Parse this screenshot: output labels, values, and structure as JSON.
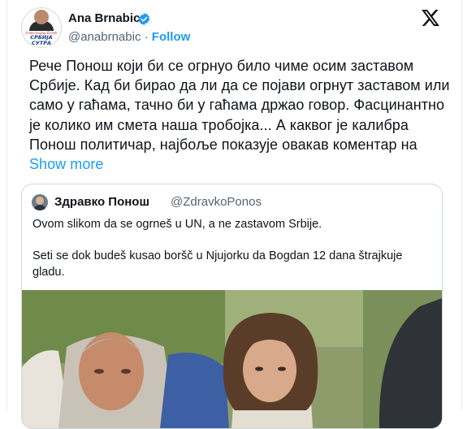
{
  "tweet": {
    "author": {
      "name": "Ana Brnabic",
      "handle": "@anabrnabic",
      "separator": "·",
      "follow_label": "Follow",
      "avatar_small_text": "Александар Вучић",
      "avatar_logo_line1": "СРБИЈА",
      "avatar_logo_line2": "СУТРА",
      "verified_icon": "verified-badge-icon"
    },
    "brand_icon": "x-logo-icon",
    "text": "Рече Понош који би се огрнуо било чиме осим заставом Србије. Кад би бирао да ли да се појави огрнут заставом или само у гаћама, тачно би у гаћама држао говор. Фасцинантно је колико им смета наша тробојка... А каквог је калибра Понош политичар, најбоље показује овакав коментар на ",
    "show_more_label": "Show more",
    "colors": {
      "accent": "#1d9bf0",
      "text": "#0f1419",
      "muted": "#536471",
      "border": "#cfd9de"
    }
  },
  "quote": {
    "author_name": "Здравко Понош",
    "author_handle": "@ZdravkoPonos",
    "text_line1": "Ovom slikom da se ogrneš u UN, a ne zastavom Srbije.",
    "text_line2": "Seti se dok budeš kusao boršč u Njujorku da Bogdan 12 dana štrajkuje gladu."
  }
}
